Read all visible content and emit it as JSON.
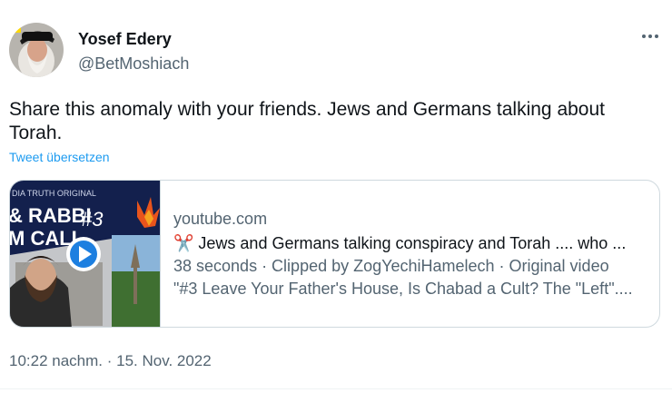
{
  "author": {
    "display_name": "Yosef Edery",
    "handle": "@BetMoshiach"
  },
  "tweet": {
    "text": "Share this anomaly with your friends. Jews and Germans talking about Torah.",
    "translate_label": "Tweet übersetzen",
    "timestamp": "10:22 nachm. · 15. Nov. 2022"
  },
  "card": {
    "domain": "youtube.com",
    "title": "✂️  Jews and Germans talking conspiracy and Torah .... who ...",
    "clip_info": "38 seconds · Clipped by ZogYechiHamelech · Original video",
    "video_description": "\"#3 Leave Your Father's House, Is Chabad a Cult? The \"Left\"....",
    "thumbnail_text": {
      "line1": "DIA TRUTH ORIGINAL",
      "line2": "& RABBI",
      "line3": "M CALL",
      "episode": "#3"
    }
  },
  "icons": {
    "more": "more-horizontal-icon",
    "play": "play-icon",
    "scissors": "scissors-icon"
  },
  "colors": {
    "link": "#1d9bf0",
    "secondary_text": "#536471",
    "primary_text": "#0f1419",
    "thumbnail_bg": "#13204d",
    "play_button": "#1d7fe0"
  }
}
